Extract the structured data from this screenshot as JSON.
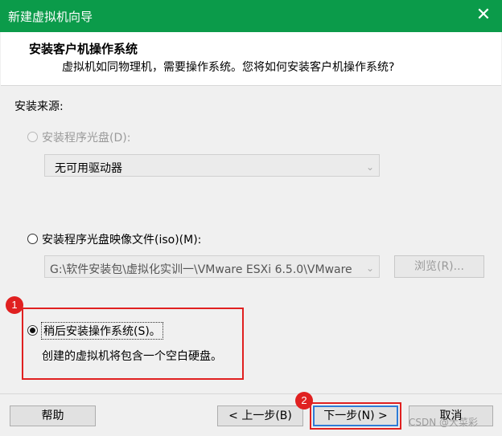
{
  "window": {
    "title": "新建虚拟机向导",
    "close_glyph": "✕"
  },
  "header": {
    "title": "安装客户机操作系统",
    "subtitle": "虚拟机如同物理机，需要操作系统。您将如何安装客户机操作系统?"
  },
  "install_source": {
    "label": "安装来源:",
    "option_disc": {
      "label": "安装程序光盘(D):",
      "enabled": false,
      "selected": false
    },
    "disc_drive_select": {
      "value": "无可用驱动器"
    },
    "option_iso": {
      "label": "安装程序光盘映像文件(iso)(M):",
      "enabled": true,
      "selected": false
    },
    "iso_path_select": {
      "value": "G:\\软件安装包\\虚拟化实训一\\VMware ESXi 6.5.0\\VMware"
    },
    "browse_button": "浏览(R)...",
    "option_later": {
      "label": "稍后安装操作系统(S)。",
      "enabled": true,
      "selected": true
    },
    "later_description": "创建的虚拟机将包含一个空白硬盘。"
  },
  "annotations": {
    "badge_1": "1",
    "badge_2": "2",
    "color": "#e02020"
  },
  "footer": {
    "help_button": "帮助",
    "back_button": "< 上一步(B)",
    "next_button": "下一步(N) >",
    "cancel_button": "取消"
  },
  "watermark": "CSDN @大菜彩",
  "colors": {
    "titlebar": "#0b9b4a",
    "background": "#f0f0f0",
    "focus_border": "#2f7bd6"
  }
}
